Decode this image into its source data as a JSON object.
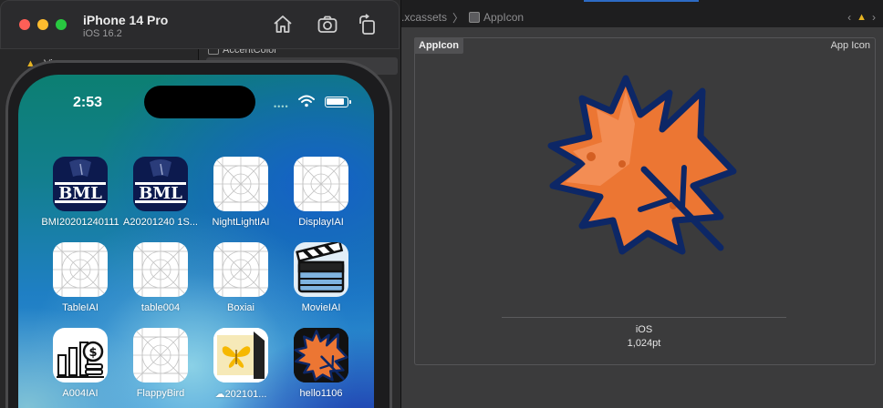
{
  "xcode": {
    "nav_item": "Vi",
    "asset_item": "AccentColor",
    "breadcrumb": {
      "folder": ".xcassets",
      "separator": "〉",
      "current": "AppIcon"
    },
    "panel_tag": "AppIcon",
    "panel_right_label": "App Icon",
    "slot_platform": "iOS",
    "slot_size": "1,024pt"
  },
  "simulator": {
    "title": "iPhone 14 Pro",
    "subtitle": "iOS 16.2",
    "status_time": "2:53",
    "apps": [
      {
        "label": "BMI20201240111",
        "icon": "bml-icon",
        "text": "BML"
      },
      {
        "label": "A20201240 1S...",
        "icon": "bml-icon",
        "text": "BML"
      },
      {
        "label": "NightLightIAI",
        "icon": "placeholder-grid-icon"
      },
      {
        "label": "DisplayIAI",
        "icon": "placeholder-grid-icon"
      },
      {
        "label": "TableIAI",
        "icon": "placeholder-grid-icon"
      },
      {
        "label": "table004",
        "icon": "placeholder-grid-icon"
      },
      {
        "label": "Boxiai",
        "icon": "placeholder-grid-icon"
      },
      {
        "label": "MovieIAI",
        "icon": "clapperboard-icon"
      },
      {
        "label": "A004IAI",
        "icon": "money-chart-icon"
      },
      {
        "label": "FlappyBird",
        "icon": "placeholder-grid-icon"
      },
      {
        "label": "202101...",
        "icon": "butterfly-icon"
      },
      {
        "label": "hello1106",
        "icon": "maple-leaf-icon"
      }
    ]
  },
  "colors": {
    "leaf_orange": "#ec7633",
    "leaf_light": "#f5925a",
    "leaf_outline": "#0d2766",
    "bml_navy": "#0c1a4e"
  }
}
